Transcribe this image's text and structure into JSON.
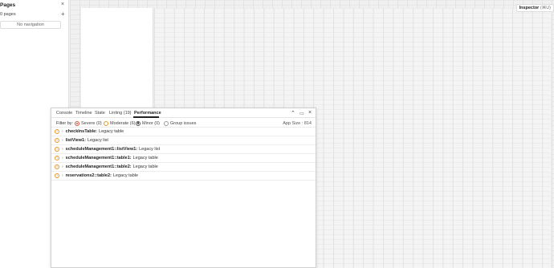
{
  "pages_panel": {
    "title": "Pages",
    "close_icon": "close-icon",
    "count_label": "0 pages",
    "add_icon": "plus-icon",
    "nav_label": "No navigation"
  },
  "inspector": {
    "label": "Inspector",
    "shortcut": "(⌘U)"
  },
  "debug_panel": {
    "tabs": [
      "Console",
      "Timeline",
      "State",
      "Linting (19)",
      "Performance"
    ],
    "active_tab": "Performance",
    "filter": {
      "label": "Filter by:",
      "options": [
        "Severe (0)",
        "Moderate (6)",
        "Minor (0)",
        "Group issues"
      ]
    },
    "app_size": "App Size : 814",
    "issues": [
      {
        "name": "checkInsTable:",
        "desc": "Legacy table"
      },
      {
        "name": "listView1:",
        "desc": "Legacy list"
      },
      {
        "name": "scheduleManagement1::listView1:",
        "desc": "Legacy list"
      },
      {
        "name": "scheduleManagement1::table1:",
        "desc": "Legacy table"
      },
      {
        "name": "scheduleManagement1::table2:",
        "desc": "Legacy table"
      },
      {
        "name": "reservations2::table2:",
        "desc": "Legacy table"
      }
    ]
  },
  "colors": {
    "severe": "#e0533b",
    "moderate": "#e8952d"
  }
}
